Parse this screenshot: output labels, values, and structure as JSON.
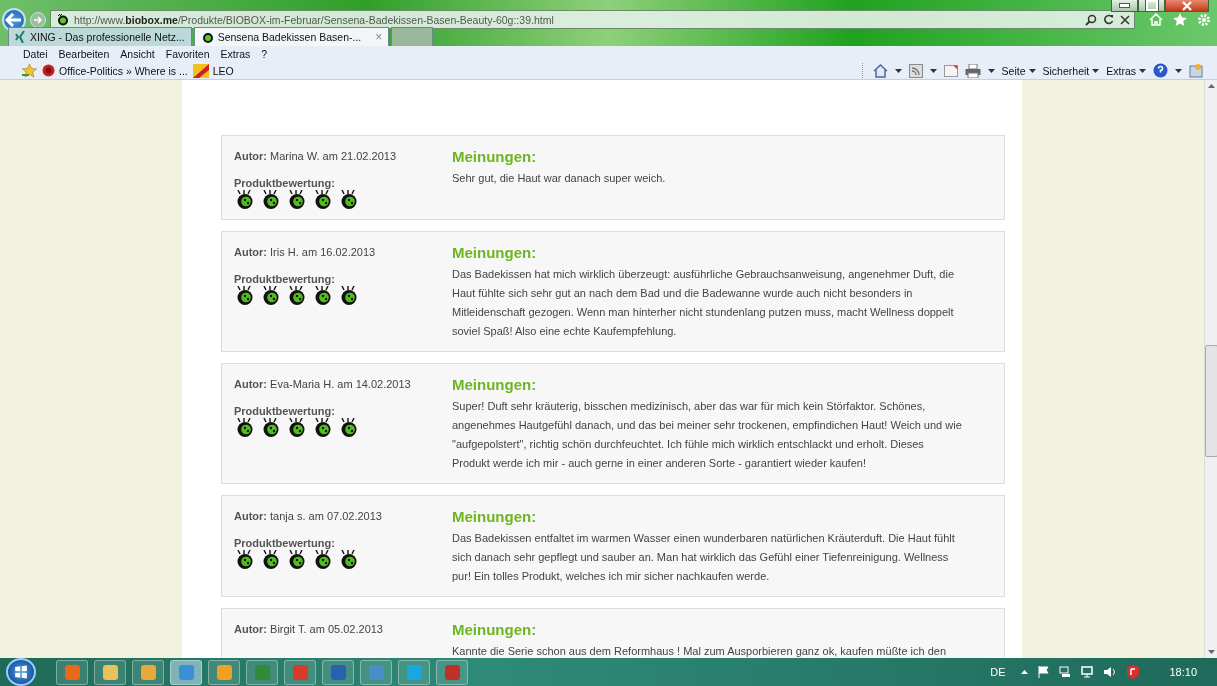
{
  "browser": {
    "url_prefix": "http://www.",
    "url_domain": "biobox.me",
    "url_path": "/Produkte/BIOBOX-im-Februar/Sensena-Badekissen-Basen-Beauty-60g::39.html"
  },
  "tabs": [
    {
      "label": "XING - Das professionelle Netz...",
      "selected": false,
      "kind": "xing"
    },
    {
      "label": "Sensena Badekissen Basen-...",
      "selected": true,
      "kind": "biobox"
    }
  ],
  "tab_close": "×",
  "menu": [
    "Datei",
    "Bearbeiten",
    "Ansicht",
    "Favoriten",
    "Extras",
    "?"
  ],
  "favorites": [
    {
      "label": "Office-Politics » Where is ...",
      "kind": "circle"
    },
    {
      "label": "LEO",
      "kind": "leo"
    }
  ],
  "command_bar": [
    "Seite",
    "Sicherheit",
    "Extras"
  ],
  "reviews": [
    {
      "author_label": "Autor:",
      "author": "Marina W. am 21.02.2013",
      "rating_label": "Produktbewertung:",
      "stars": 5,
      "heading": "Meinungen:",
      "text": "Sehr gut, die Haut war danach super weich."
    },
    {
      "author_label": "Autor:",
      "author": "Iris H. am 16.02.2013",
      "rating_label": "Produktbewertung:",
      "stars": 5,
      "heading": "Meinungen:",
      "text": "Das Badekissen hat mich wirklich überzeugt: ausführliche Gebrauchsanweisung, angenehmer Duft, die Haut fühlte sich sehr gut an nach dem Bad und die Badewanne wurde auch nicht besonders in Mitleidenschaft gezogen. Wenn man hinterher nicht stundenlang putzen muss, macht Wellness doppelt soviel Spaß! Also eine echte Kaufempfehlung."
    },
    {
      "author_label": "Autor:",
      "author": "Eva-Maria H. am 14.02.2013",
      "rating_label": "Produktbewertung:",
      "stars": 5,
      "heading": "Meinungen:",
      "text": "Super! Duft sehr kräuterig, bisschen medizinisch, aber das war für mich kein Störfaktor. Schönes, angenehmes Hautgefühl danach, und das bei meiner sehr trockenen, empfindichen Haut! Weich und wie \"aufgepolstert\", richtig schön durchfeuchtet. Ich fühle mich wirklich entschlackt und erholt. Dieses Produkt werde ich mir - auch gerne in einer anderen Sorte - garantiert wieder kaufen!"
    },
    {
      "author_label": "Autor:",
      "author": "tanja s. am 07.02.2013",
      "rating_label": "Produktbewertung:",
      "stars": 5,
      "heading": "Meinungen:",
      "text": "Das Badekissen entfaltet im warmen Wasser einen wunderbaren natürlichen Kräuterduft. Die Haut fühlt sich danach sehr gepflegt und sauber an. Man hat wirklich das Gefühl einer Tiefenreinigung. Wellness pur! Ein tolles Produkt, welches ich mir sicher nachkaufen werde."
    },
    {
      "author_label": "Autor:",
      "author": "Birgit T. am 05.02.2013",
      "heading": "Meinungen:",
      "text": "Kannte die Serie schon aus dem Reformhaus ! Mal zum Ausporbieren ganz ok, kaufen müßte ich den"
    }
  ],
  "taskbar": {
    "apps": [
      {
        "selected": false,
        "color": "#e66a1a"
      },
      {
        "selected": false,
        "color": "#e8c25a"
      },
      {
        "selected": false,
        "color": "#e9a83a"
      },
      {
        "selected": true,
        "color": "#3a8fd8"
      },
      {
        "selected": false,
        "color": "#f0a020"
      },
      {
        "selected": false,
        "color": "#2f8b3a"
      },
      {
        "selected": false,
        "color": "#d83a2a"
      },
      {
        "selected": false,
        "color": "#2b5fb0"
      },
      {
        "selected": false,
        "color": "#4a8ec8"
      },
      {
        "selected": false,
        "color": "#18a7e0"
      },
      {
        "selected": false,
        "color": "#c0302a"
      }
    ],
    "language": "DE",
    "clock": "18:10"
  }
}
